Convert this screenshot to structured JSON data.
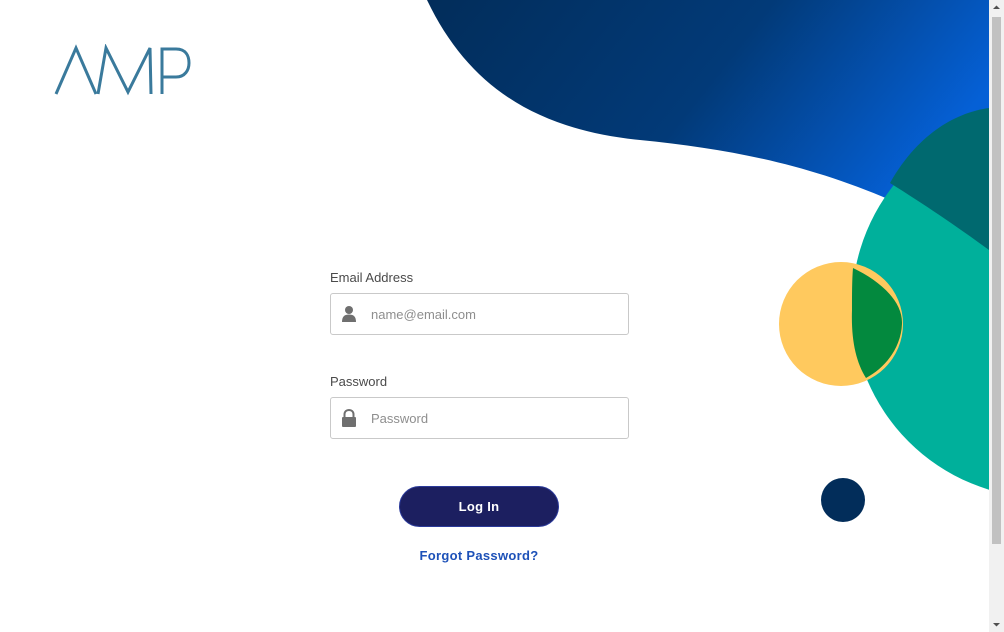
{
  "brand": {
    "logo_text": "AMP",
    "logo_color": "#3a7a9c"
  },
  "form": {
    "email_label": "Email Address",
    "email_placeholder": "name@email.com",
    "email_value": "",
    "password_label": "Password",
    "password_placeholder": "Password",
    "password_value": "",
    "login_label": "Log In",
    "forgot_label": "Forgot Password?"
  },
  "icons": {
    "email": "user-icon",
    "password": "lock-icon"
  },
  "colors": {
    "button_bg": "#1c1f60",
    "link": "#1d51b8",
    "navy": "#022d5a",
    "blue": "#0557c9",
    "teal": "#00b09b",
    "yellow": "#ffc95e",
    "green_overlap": "#03893e"
  }
}
